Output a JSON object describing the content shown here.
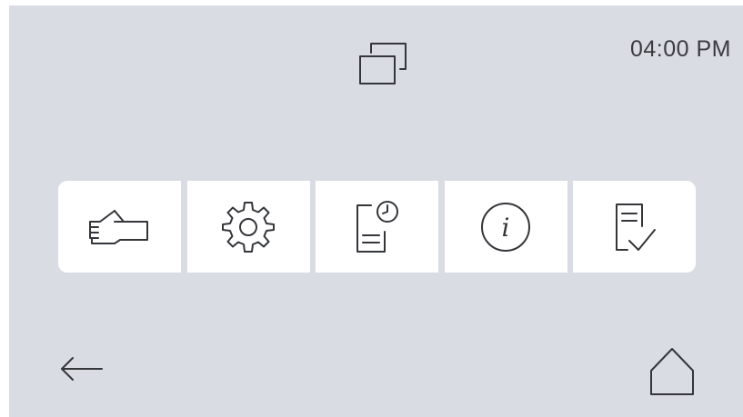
{
  "status_bar": {
    "time": "04:00 PM",
    "window_switch_icon": "windows-stack-icon"
  },
  "toolbar": {
    "items": [
      {
        "id": "manual",
        "icon": "hand-icon"
      },
      {
        "id": "settings",
        "icon": "gear-icon"
      },
      {
        "id": "history",
        "icon": "document-clock-icon"
      },
      {
        "id": "info",
        "icon": "info-icon",
        "glyph": "i"
      },
      {
        "id": "checklist",
        "icon": "document-check-icon"
      }
    ]
  },
  "navigation": {
    "back_icon": "arrow-left-icon",
    "home_icon": "home-icon"
  },
  "colors": {
    "background": "#d9dce3",
    "panel": "#ffffff",
    "icon_stroke": "#34363a"
  }
}
